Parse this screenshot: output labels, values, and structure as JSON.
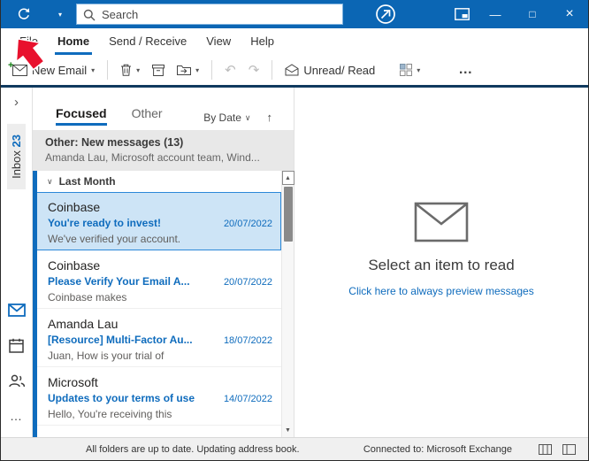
{
  "colors": {
    "titlebar": "#0b66b4",
    "accent": "#0f6cbd",
    "selected_email_bg": "#cde4f6",
    "unread_stripe": "#0f6cbd",
    "ribbon_underline": "#103a5f",
    "annotation_arrow": "#e8112d"
  },
  "glyphs": {
    "dropdown_chevron": "▾",
    "thin_chevron": "∨",
    "sort_up_arrow": "↑",
    "rail_expand": "›",
    "undo": "↶",
    "redo": "↷",
    "more_dots": "…",
    "minimize": "—",
    "maximize": "□",
    "close": "×",
    "scroll_up": "▲",
    "scroll_down": "▼"
  },
  "titlebar": {
    "search_placeholder": "Search"
  },
  "menubar": {
    "items": [
      {
        "label": "File"
      },
      {
        "label": "Home"
      },
      {
        "label": "Send / Receive"
      },
      {
        "label": "View"
      },
      {
        "label": "Help"
      }
    ],
    "active": "Home"
  },
  "ribbon": {
    "new_email_label": "New Email",
    "unread_read_label": "Unread/ Read"
  },
  "rail": {
    "inbox_label": "Inbox",
    "inbox_count": "23"
  },
  "list": {
    "focused_tab": "Focused",
    "other_tab": "Other",
    "sort_label": "By Date",
    "banner_title": "Other: New messages (13)",
    "banner_preview": "Amanda Lau, Microsoft account team, Wind...",
    "group_header": "Last Month",
    "emails": [
      {
        "sender": "Coinbase",
        "subject": "You're ready to invest!",
        "date": "20/07/2022",
        "preview": "We've verified your account.",
        "selected": true
      },
      {
        "sender": "Coinbase",
        "subject": "Please Verify Your Email A...",
        "date": "20/07/2022",
        "preview": "Coinbase makes",
        "selected": false
      },
      {
        "sender": "Amanda Lau",
        "subject": "[Resource] Multi-Factor Au...",
        "date": "18/07/2022",
        "preview": "Juan,  How is your trial of",
        "selected": false
      },
      {
        "sender": "Microsoft",
        "subject": "Updates to your terms of use",
        "date": "14/07/2022",
        "preview": "Hello, You're receiving this",
        "selected": false
      }
    ]
  },
  "reading_pane": {
    "empty_title": "Select an item to read",
    "empty_link": "Click here to always preview messages"
  },
  "statusbar": {
    "left_text": "All folders are up to date.  Updating address book.",
    "connection_text": "Connected to: Microsoft Exchange"
  }
}
